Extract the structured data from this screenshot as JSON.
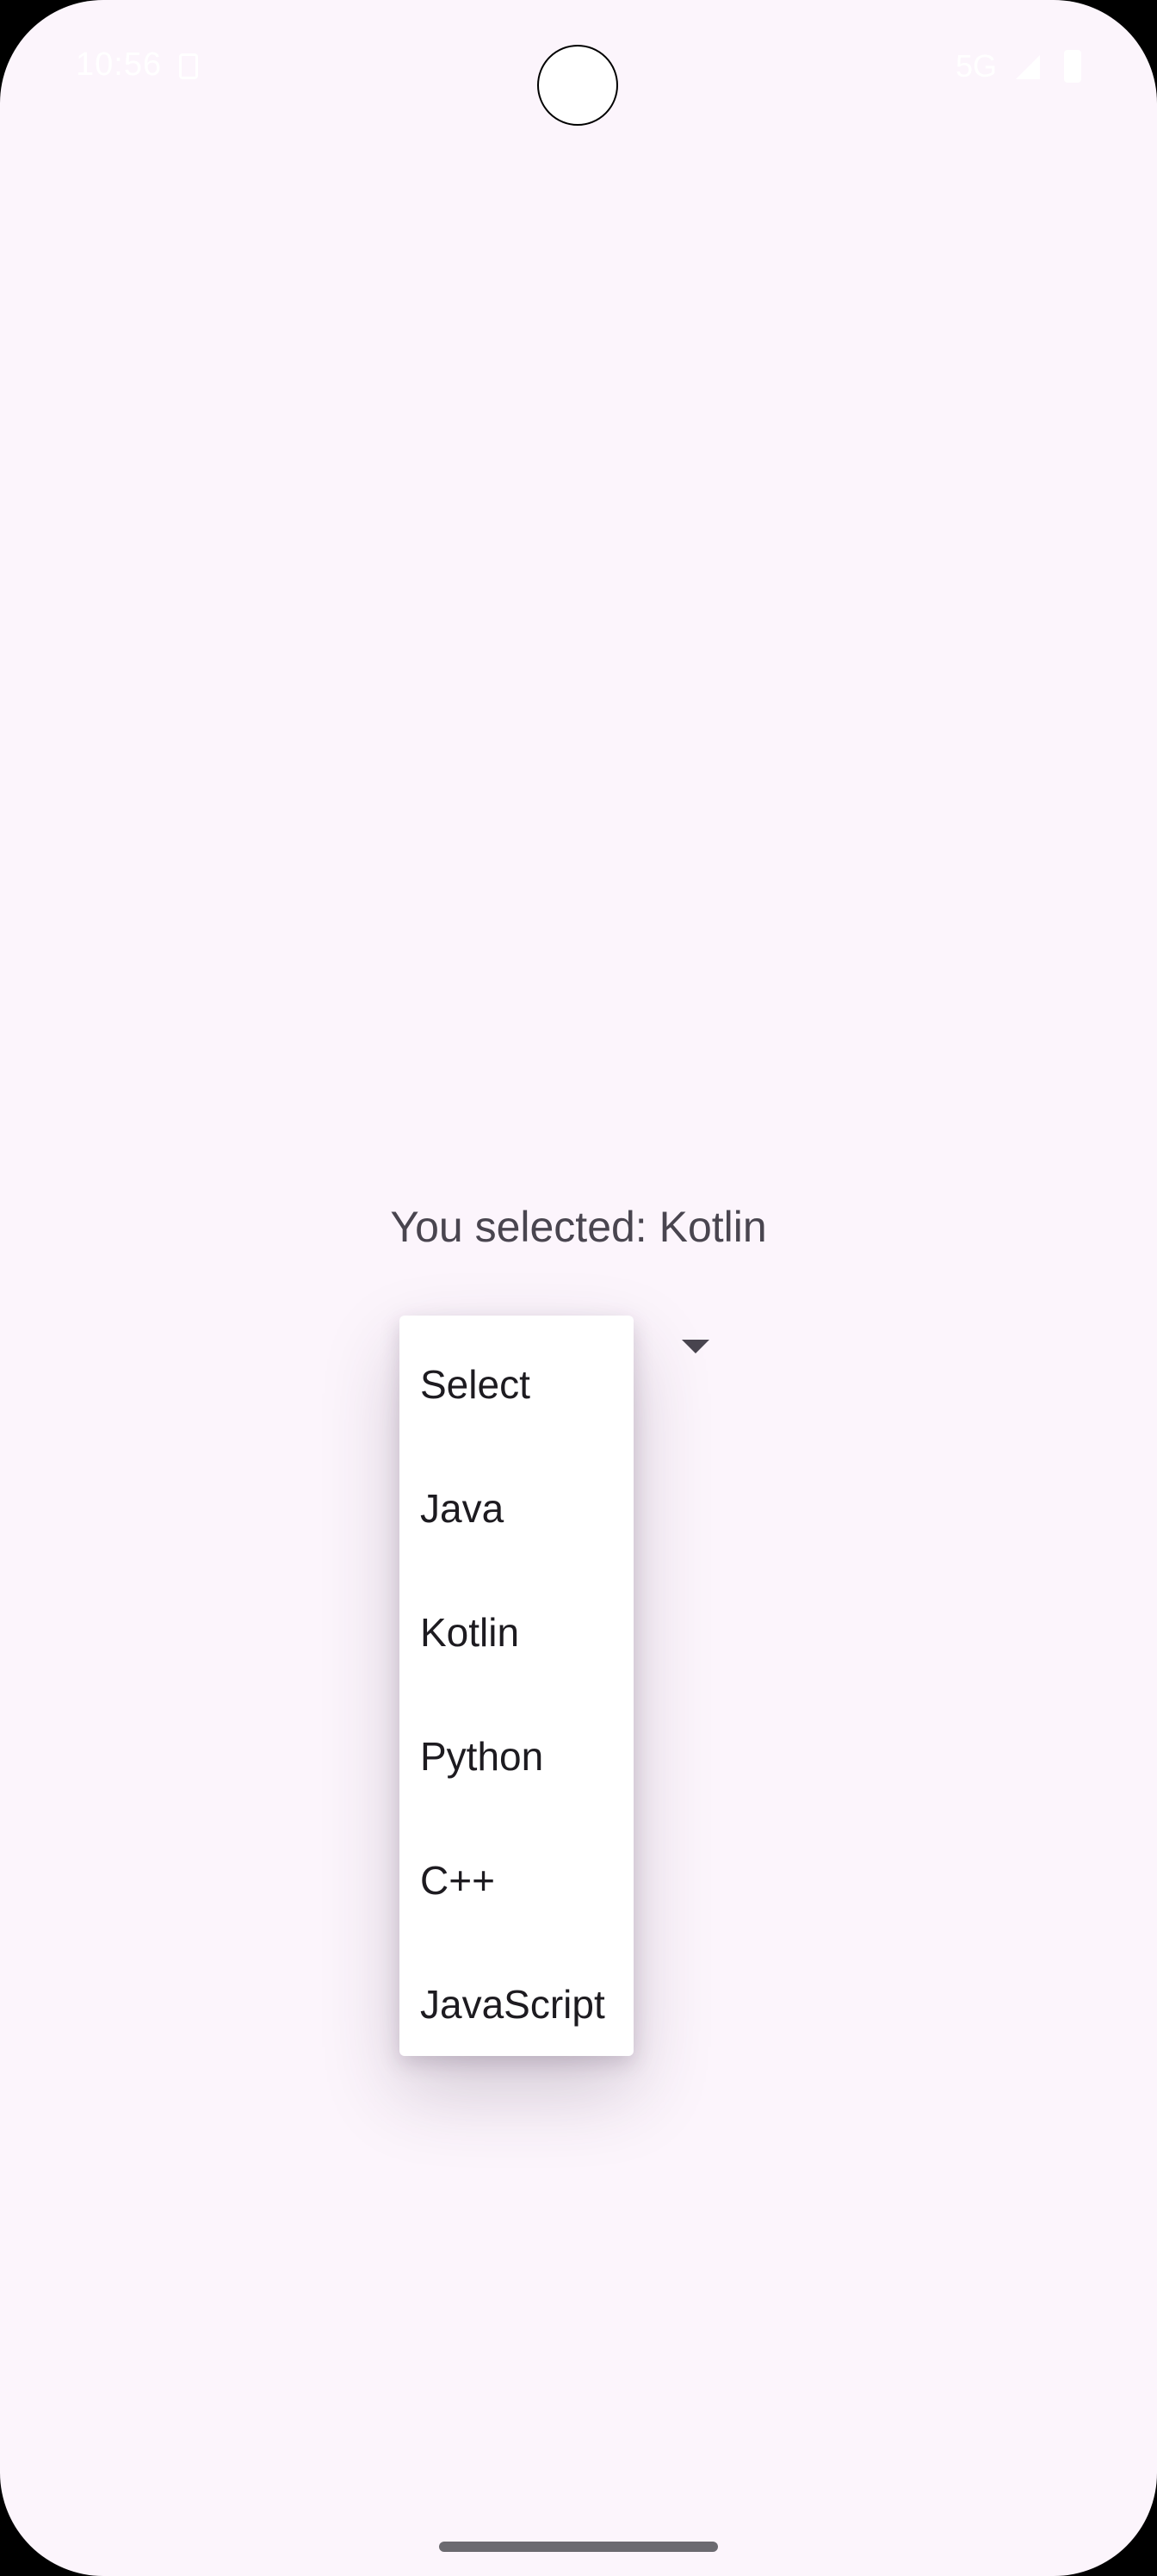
{
  "status_bar": {
    "time": "10:56",
    "network": "5G",
    "icons": [
      "sim-card-icon",
      "signal-icon",
      "battery-icon"
    ],
    "icon_color": "#ffffff"
  },
  "main": {
    "selected_text": "You selected: Kotlin",
    "selected_value": "Kotlin"
  },
  "dropdown": {
    "options": [
      "Select",
      "Java",
      "Kotlin",
      "Python",
      "C++",
      "JavaScript"
    ],
    "arrow_icon": "dropdown-arrow-icon"
  },
  "colors": {
    "background": "#fcf5fc",
    "menu_surface": "#ffffff",
    "primary_text": "#1d1b20",
    "secondary_text": "#49454f"
  }
}
